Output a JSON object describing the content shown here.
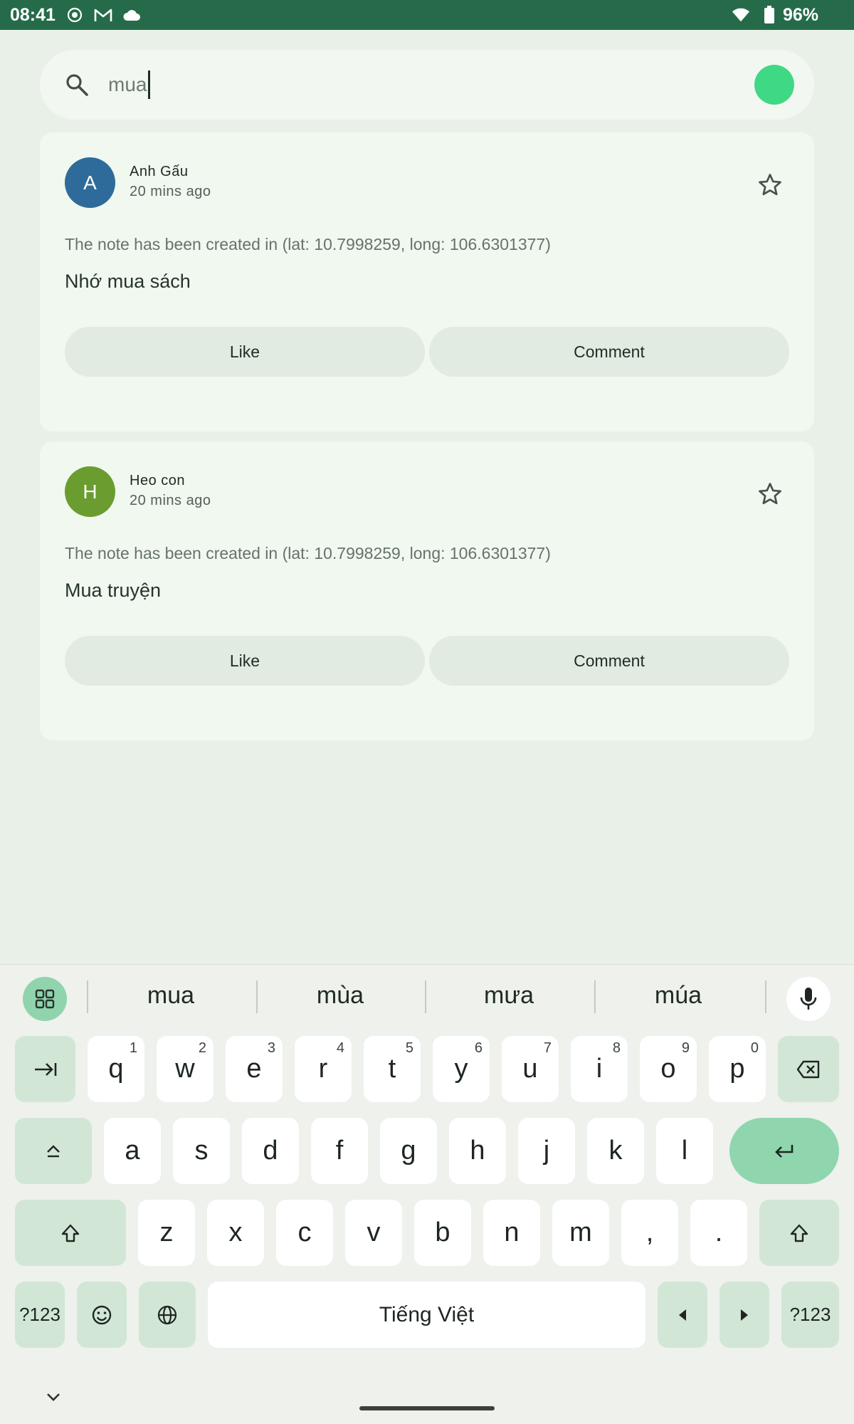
{
  "status_bar": {
    "time": "08:41",
    "battery": "96%",
    "icons": [
      "screen-record-icon",
      "gmail-icon",
      "cloud-icon",
      "wifi-icon",
      "battery-icon"
    ]
  },
  "search": {
    "query": "mua",
    "icon": "search-icon"
  },
  "notes": [
    {
      "avatar_letter": "A",
      "avatar_color": "#2f6b9a",
      "author": "Anh Gấu",
      "time_ago": "20 mins ago",
      "location": "The note has been created in (lat: 10.7998259, long: 106.6301377)",
      "text": "Nhớ mua sách",
      "like_label": "Like",
      "comment_label": "Comment"
    },
    {
      "avatar_letter": "H",
      "avatar_color": "#6b9c2f",
      "author": "Heo con",
      "time_ago": "20 mins ago",
      "location": "The note has been created in (lat: 10.7998259, long: 106.6301377)",
      "text": "Mua truyện",
      "like_label": "Like",
      "comment_label": "Comment"
    }
  ],
  "keyboard": {
    "suggestions": [
      "mua",
      "mùa",
      "mưa",
      "múa"
    ],
    "row1": [
      {
        "k": "q",
        "s": "1"
      },
      {
        "k": "w",
        "s": "2"
      },
      {
        "k": "e",
        "s": "3"
      },
      {
        "k": "r",
        "s": "4"
      },
      {
        "k": "t",
        "s": "5"
      },
      {
        "k": "y",
        "s": "6"
      },
      {
        "k": "u",
        "s": "7"
      },
      {
        "k": "i",
        "s": "8"
      },
      {
        "k": "o",
        "s": "9"
      },
      {
        "k": "p",
        "s": "0"
      }
    ],
    "row2": [
      "a",
      "s",
      "d",
      "f",
      "g",
      "h",
      "j",
      "k",
      "l"
    ],
    "row3": [
      "z",
      "x",
      "c",
      "v",
      "b",
      "n",
      "m",
      ",",
      "."
    ],
    "symbols_label": "?123",
    "space_label": "Tiếng Việt"
  },
  "colors": {
    "status_bar": "#256b4a",
    "background": "#e8f0e8",
    "card": "#f0f8f0",
    "accent": "#8fd6ae"
  }
}
